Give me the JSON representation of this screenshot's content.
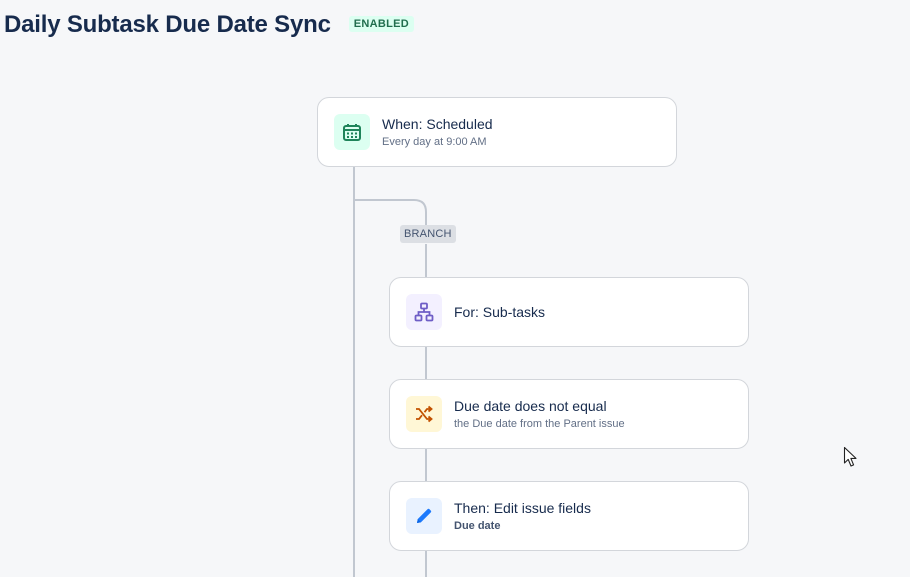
{
  "header": {
    "title": "Daily Subtask Due Date Sync",
    "status_badge": "ENABLED"
  },
  "flow": {
    "trigger": {
      "title": "When: Scheduled",
      "subtitle": "Every day at 9:00 AM",
      "icon": "calendar-icon",
      "icon_bg": "#dcfff1",
      "icon_color": "#1f845a"
    },
    "branch_label": "BRANCH",
    "branch_for": {
      "title": "For: Sub-tasks",
      "icon": "hierarchy-icon",
      "icon_bg": "#f3f0ff",
      "icon_color": "#6e5dc6"
    },
    "condition": {
      "title": "Due date does not equal",
      "subtitle": "the Due date from the Parent issue",
      "icon": "shuffle-icon",
      "icon_bg": "#fff7d6",
      "icon_color": "#c25100"
    },
    "action": {
      "title": "Then: Edit issue fields",
      "subtitle": "Due date",
      "icon": "pencil-icon",
      "icon_bg": "#e9f2ff",
      "icon_color": "#1d7afc"
    }
  }
}
